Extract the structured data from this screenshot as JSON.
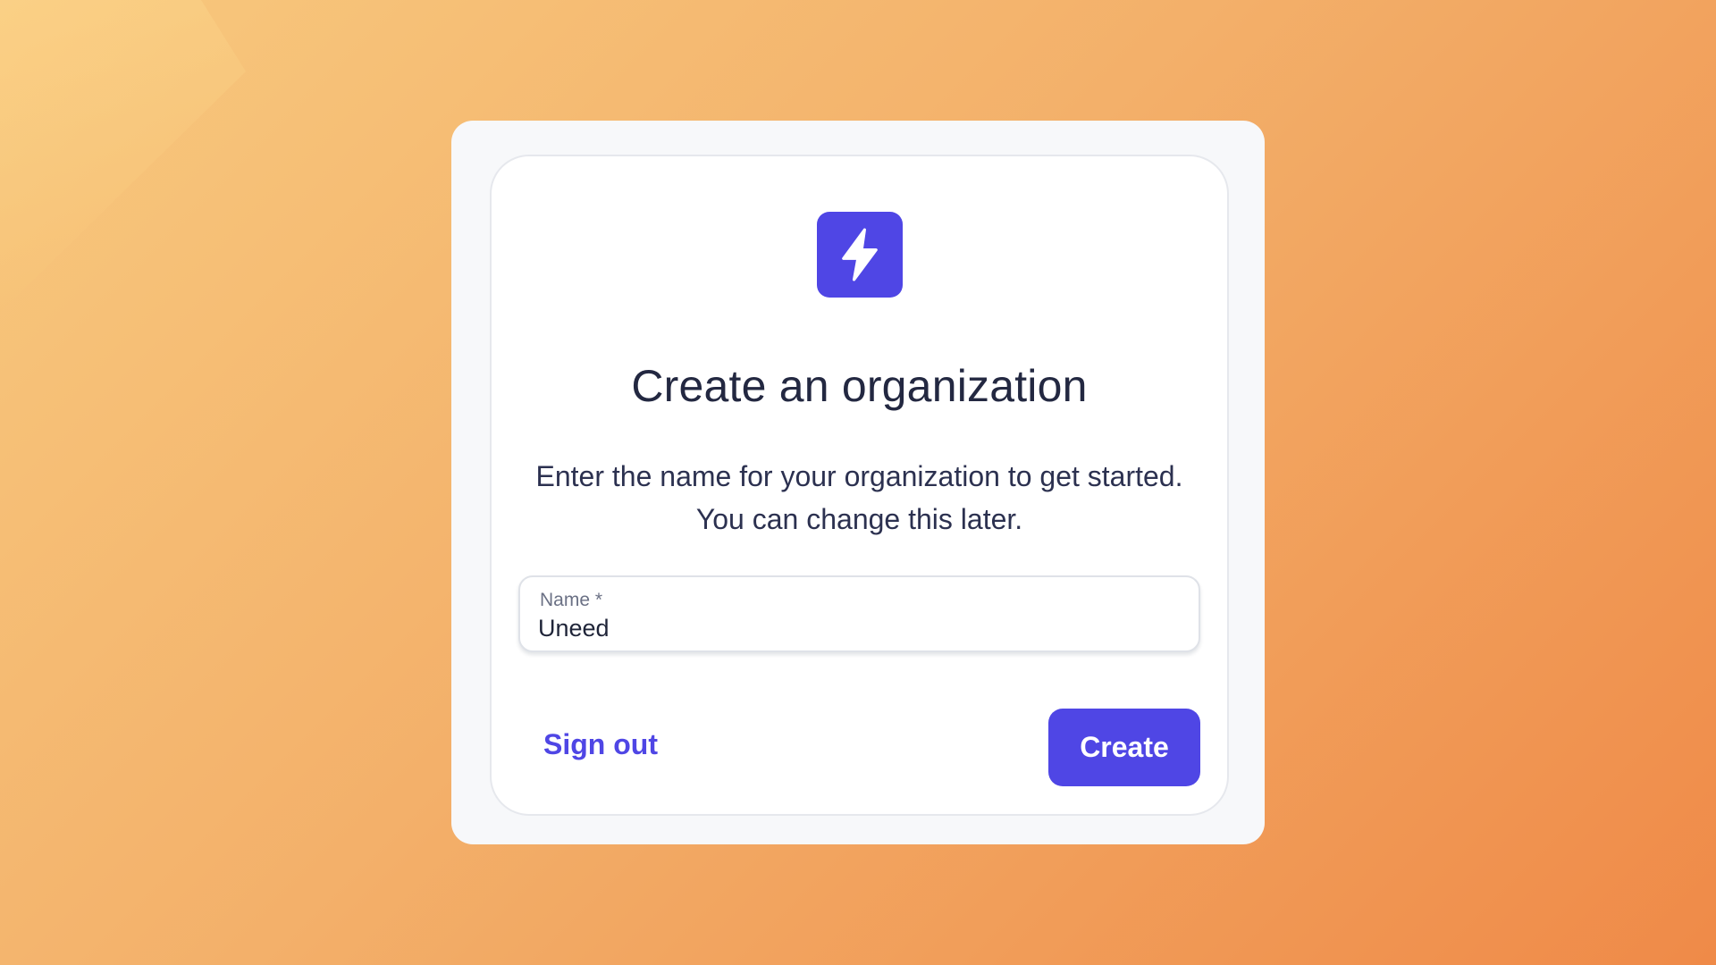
{
  "brand": {
    "logo_icon": "lightning-bolt-icon",
    "accent_color": "#4f46e5"
  },
  "dialog": {
    "title": "Create an organization",
    "description_line1": "Enter the name for your organization to get started.",
    "description_line2": "You can change this later."
  },
  "form": {
    "name_label": "Name *",
    "name_value": "Uneed"
  },
  "actions": {
    "signout_label": "Sign out",
    "create_label": "Create"
  }
}
